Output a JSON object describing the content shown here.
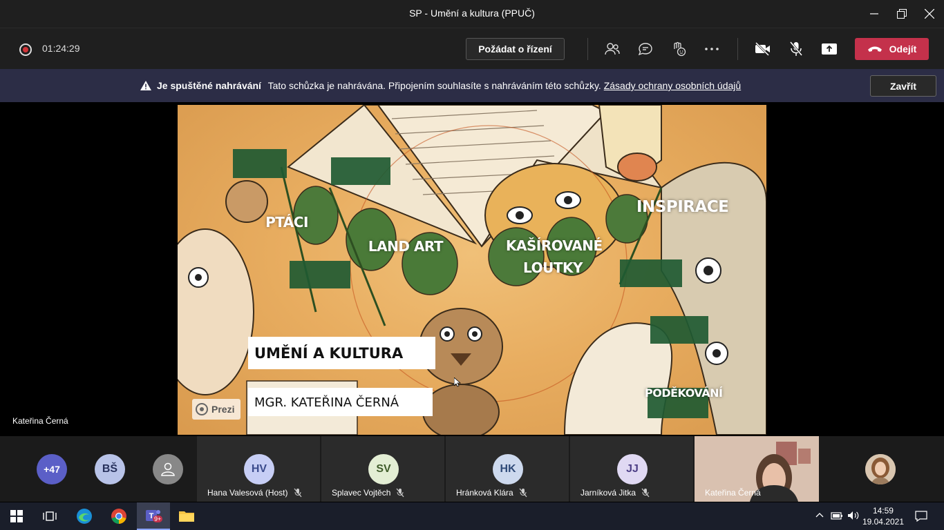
{
  "window": {
    "title": "SP - Umění a kultura (PPUČ)"
  },
  "toolbar": {
    "timer": "01:24:29",
    "request_control_label": "Požádat o řízení",
    "leave_label": "Odejít"
  },
  "banner": {
    "title": "Je spuštěné nahrávání",
    "message": "Tato schůzka je nahrávána. Připojením souhlasíte s nahráváním této schůzky.",
    "link": "Zásady ochrany osobních údajů",
    "close_label": "Zavřít"
  },
  "slide": {
    "labels": {
      "ptaci": "PTÁCI",
      "land_art": "LAND ART",
      "kasirovane_1": "KAŠÍROVANÉ",
      "kasirovane_2": "LOUTKY",
      "inspirace": "INSPIRACE",
      "podekovani": "PODĚKOVÁNÍ"
    },
    "title": "UMĚNÍ A KULTURA",
    "author": "MGR. KATEŘINA ČERNÁ",
    "badge": "Prezi"
  },
  "presenter": {
    "name": "Kateřina Černá"
  },
  "participants": {
    "more": "+47",
    "initials_bs": "BŠ",
    "tiles": [
      {
        "initials": "HV",
        "name": "Hana Valesová (Host)"
      },
      {
        "initials": "SV",
        "name": "Splavec Vojtěch"
      },
      {
        "initials": "HK",
        "name": "Hránková Klára"
      },
      {
        "initials": "JJ",
        "name": "Jarníková Jitka"
      }
    ],
    "video_name": "Kateřina Černá"
  },
  "taskbar": {
    "teams_badge": "9+",
    "time": "14:59",
    "date": "19.04.2021"
  },
  "colors": {
    "leave": "#c4314b",
    "banner": "#2c2d46",
    "slide_green": "#1f5a32"
  }
}
